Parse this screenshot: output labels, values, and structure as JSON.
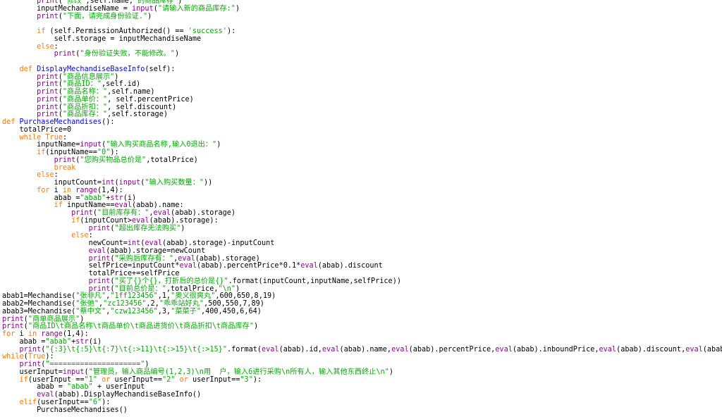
{
  "colors": {
    "background": "#ffffff",
    "text": "#000000",
    "keyword": "#ff7700",
    "builtin": "#900090",
    "string": "#00aa00",
    "definition": "#0000ff"
  },
  "lines": [
    [
      [
        "bi",
        "        print"
      ],
      [
        "txt",
        "("
      ],
      [
        "str",
        "\"修改\""
      ],
      [
        "txt",
        ",self.name,"
      ],
      [
        "str",
        "\"的商品库存\""
      ],
      [
        "txt",
        ")"
      ]
    ],
    [
      [
        "txt",
        "        inputMechandiseName = "
      ],
      [
        "bi",
        "input"
      ],
      [
        "txt",
        "("
      ],
      [
        "str",
        "\"请输入新的商品库存:\""
      ],
      [
        "txt",
        ")"
      ]
    ],
    [
      [
        "bi",
        "        print"
      ],
      [
        "txt",
        "("
      ],
      [
        "str",
        "\"下面，请完成身份验证.\""
      ],
      [
        "txt",
        ")"
      ]
    ],
    [
      [
        "txt",
        " "
      ]
    ],
    [
      [
        "kw",
        "        if"
      ],
      [
        "txt",
        " (self.PermissionAuthorized() == "
      ],
      [
        "str",
        "'success'"
      ],
      [
        "txt",
        "):"
      ]
    ],
    [
      [
        "txt",
        "            self.storage = inputMechandiseName"
      ]
    ],
    [
      [
        "kw",
        "        else"
      ],
      [
        "txt",
        ":"
      ]
    ],
    [
      [
        "bi",
        "            print"
      ],
      [
        "txt",
        "("
      ],
      [
        "str",
        "\"身份验证失败，不能修改。\""
      ],
      [
        "txt",
        ")"
      ]
    ],
    [
      [
        "txt",
        " "
      ]
    ],
    [
      [
        "kw",
        "    def"
      ],
      [
        "txt",
        " "
      ],
      [
        "def",
        "DisplayMechandiseBaseInfo"
      ],
      [
        "txt",
        "(self):"
      ]
    ],
    [
      [
        "bi",
        "        print"
      ],
      [
        "txt",
        "("
      ],
      [
        "str",
        "\"商品信息展示\""
      ],
      [
        "txt",
        ")"
      ]
    ],
    [
      [
        "bi",
        "        print"
      ],
      [
        "txt",
        "("
      ],
      [
        "str",
        "\"商品ID：\""
      ],
      [
        "txt",
        ",self.id)"
      ]
    ],
    [
      [
        "bi",
        "        print"
      ],
      [
        "txt",
        "("
      ],
      [
        "str",
        "\"商品名称：\""
      ],
      [
        "txt",
        ",self.name)"
      ]
    ],
    [
      [
        "bi",
        "        print"
      ],
      [
        "txt",
        "("
      ],
      [
        "str",
        "\"商品单价：\""
      ],
      [
        "txt",
        ", self.percentPrice)"
      ]
    ],
    [
      [
        "bi",
        "        print"
      ],
      [
        "txt",
        "("
      ],
      [
        "str",
        "\"商品折扣：\""
      ],
      [
        "txt",
        ", self.discount)"
      ]
    ],
    [
      [
        "bi",
        "        print"
      ],
      [
        "txt",
        "("
      ],
      [
        "str",
        "\"商品库存：\""
      ],
      [
        "txt",
        ",self.storage)"
      ]
    ],
    [
      [
        "kw",
        "def"
      ],
      [
        "txt",
        " "
      ],
      [
        "def",
        "PurchaseMechandises"
      ],
      [
        "txt",
        "():"
      ]
    ],
    [
      [
        "txt",
        "    totalPrice=0"
      ]
    ],
    [
      [
        "kw",
        "    while"
      ],
      [
        "txt",
        " "
      ],
      [
        "kw",
        "True"
      ],
      [
        "txt",
        ":"
      ]
    ],
    [
      [
        "txt",
        "        inputName="
      ],
      [
        "bi",
        "input"
      ],
      [
        "txt",
        "("
      ],
      [
        "str",
        "\"输入购买商品名称,输入0退出：\""
      ],
      [
        "txt",
        ")"
      ]
    ],
    [
      [
        "kw",
        "        if"
      ],
      [
        "txt",
        "(inputName=="
      ],
      [
        "str",
        "\"0\""
      ],
      [
        "txt",
        "):"
      ]
    ],
    [
      [
        "bi",
        "            print"
      ],
      [
        "txt",
        "("
      ],
      [
        "str",
        "\"您购买物品总价是\""
      ],
      [
        "txt",
        ",totalPrice)"
      ]
    ],
    [
      [
        "kw",
        "            break"
      ]
    ],
    [
      [
        "kw",
        "        else"
      ],
      [
        "txt",
        ":"
      ]
    ],
    [
      [
        "txt",
        "            inputCount="
      ],
      [
        "bi",
        "int"
      ],
      [
        "txt",
        "("
      ],
      [
        "bi",
        "input"
      ],
      [
        "txt",
        "("
      ],
      [
        "str",
        "\"输入购买数量：\""
      ],
      [
        "txt",
        "))"
      ]
    ],
    [
      [
        "kw",
        "        for"
      ],
      [
        "txt",
        " i "
      ],
      [
        "kw",
        "in"
      ],
      [
        "txt",
        " "
      ],
      [
        "bi",
        "range"
      ],
      [
        "txt",
        "(1,4):"
      ]
    ],
    [
      [
        "txt",
        "            abab ="
      ],
      [
        "str",
        "\"abab\""
      ],
      [
        "txt",
        "+"
      ],
      [
        "bi",
        "str"
      ],
      [
        "txt",
        "(i)"
      ]
    ],
    [
      [
        "kw",
        "            if"
      ],
      [
        "txt",
        " inputName=="
      ],
      [
        "bi",
        "eval"
      ],
      [
        "txt",
        "(abab).name:"
      ]
    ],
    [
      [
        "bi",
        "                print"
      ],
      [
        "txt",
        "("
      ],
      [
        "str",
        "\"目前库存有：\""
      ],
      [
        "txt",
        ","
      ],
      [
        "bi",
        "eval"
      ],
      [
        "txt",
        "(abab).storage)"
      ]
    ],
    [
      [
        "kw",
        "                if"
      ],
      [
        "txt",
        "(inputCount>"
      ],
      [
        "bi",
        "eval"
      ],
      [
        "txt",
        "(abab).storage):"
      ]
    ],
    [
      [
        "bi",
        "                    print"
      ],
      [
        "txt",
        "("
      ],
      [
        "str",
        "\"超出库存无法购买\""
      ],
      [
        "txt",
        ")"
      ]
    ],
    [
      [
        "kw",
        "                else"
      ],
      [
        "txt",
        ":"
      ]
    ],
    [
      [
        "txt",
        "                    newCount="
      ],
      [
        "bi",
        "int"
      ],
      [
        "txt",
        "("
      ],
      [
        "bi",
        "eval"
      ],
      [
        "txt",
        "(abab).storage)-inputCount"
      ]
    ],
    [
      [
        "bi",
        "                    eval"
      ],
      [
        "txt",
        "(abab).storage=newCount"
      ]
    ],
    [
      [
        "bi",
        "                    print"
      ],
      [
        "txt",
        "("
      ],
      [
        "str",
        "\"采购后库存有：\""
      ],
      [
        "txt",
        ","
      ],
      [
        "bi",
        "eval"
      ],
      [
        "txt",
        "(abab).storage)"
      ]
    ],
    [
      [
        "txt",
        "                    selfPrice=inputCount*"
      ],
      [
        "bi",
        "eval"
      ],
      [
        "txt",
        "(abab).percentPrice*0.1*"
      ],
      [
        "bi",
        "eval"
      ],
      [
        "txt",
        "(abab).discount"
      ]
    ],
    [
      [
        "txt",
        "                    totalPrice+=selfPrice"
      ]
    ],
    [
      [
        "bi",
        "                    print"
      ],
      [
        "txt",
        "("
      ],
      [
        "str",
        "\"买了{}个{}，打折后的总价是{}\""
      ],
      [
        "txt",
        ".format(inputCount,inputName,selfPrice))"
      ]
    ],
    [
      [
        "bi",
        "                    print"
      ],
      [
        "txt",
        "("
      ],
      [
        "str",
        "\"目前总价是：\""
      ],
      [
        "txt",
        ",totalPrice,"
      ],
      [
        "str",
        "\"\\n\""
      ],
      [
        "txt",
        ")"
      ]
    ],
    [
      [
        "txt",
        "abab1=Mechandise("
      ],
      [
        "str",
        "\"张非凡\""
      ],
      [
        "txt",
        ","
      ],
      [
        "str",
        "\"1ff123456\""
      ],
      [
        "txt",
        ",1,"
      ],
      [
        "str",
        "\"奥义很爽丸\""
      ],
      [
        "txt",
        ",600,650,8,19)"
      ]
    ],
    [
      [
        "txt",
        "abab2=Mechandise("
      ],
      [
        "str",
        "\"张弛\""
      ],
      [
        "txt",
        ","
      ],
      [
        "str",
        "\"zc123456\""
      ],
      [
        "txt",
        ",2,"
      ],
      [
        "str",
        "\"乖乖站好丸\""
      ],
      [
        "txt",
        ",500,550,7,89)"
      ]
    ],
    [
      [
        "txt",
        "abab3=Mechandise("
      ],
      [
        "str",
        "\"蔡中文\""
      ],
      [
        "txt",
        ","
      ],
      [
        "str",
        "\"czw123456\""
      ],
      [
        "txt",
        ",3,"
      ],
      [
        "str",
        "\"菜菜子\""
      ],
      [
        "txt",
        ",400,450,6,64)"
      ]
    ],
    [
      [
        "bi",
        "print"
      ],
      [
        "txt",
        "("
      ],
      [
        "str",
        "\"商单商品展示\""
      ],
      [
        "txt",
        ")"
      ]
    ],
    [
      [
        "bi",
        "print"
      ],
      [
        "txt",
        "("
      ],
      [
        "str",
        "\"商品ID\\t商品名称\\t商品单价\\t商品进货价\\t商品折扣\\t商品库存\""
      ],
      [
        "txt",
        ")"
      ]
    ],
    [
      [
        "kw",
        "for"
      ],
      [
        "txt",
        " i "
      ],
      [
        "kw",
        "in"
      ],
      [
        "txt",
        " "
      ],
      [
        "bi",
        "range"
      ],
      [
        "txt",
        "(1,4):"
      ]
    ],
    [
      [
        "txt",
        "    abab ="
      ],
      [
        "str",
        "\"abab\""
      ],
      [
        "txt",
        "+"
      ],
      [
        "bi",
        "str"
      ],
      [
        "txt",
        "(i)"
      ]
    ],
    [
      [
        "bi",
        "    print"
      ],
      [
        "txt",
        "("
      ],
      [
        "str",
        "\"{:3}\\t{:5}\\t{:7}\\t{:>11}\\t{:>15}\\t{:>15}\""
      ],
      [
        "txt",
        ".format("
      ],
      [
        "bi",
        "eval"
      ],
      [
        "txt",
        "(abab).id,"
      ],
      [
        "bi",
        "eval"
      ],
      [
        "txt",
        "(abab).name,"
      ],
      [
        "bi",
        "eval"
      ],
      [
        "txt",
        "(abab).percentPrice,"
      ],
      [
        "bi",
        "eval"
      ],
      [
        "txt",
        "(abab).inboundPrice,"
      ],
      [
        "bi",
        "eval"
      ],
      [
        "txt",
        "(abab).discount,"
      ],
      [
        "bi",
        "eval"
      ],
      [
        "txt",
        "(abab).storage))"
      ]
    ],
    [
      [
        "kw",
        "while"
      ],
      [
        "txt",
        "("
      ],
      [
        "kw",
        "True"
      ],
      [
        "txt",
        "):"
      ]
    ],
    [
      [
        "bi",
        "    print"
      ],
      [
        "txt",
        "("
      ],
      [
        "str",
        "\"=====================\""
      ],
      [
        "txt",
        ")"
      ]
    ],
    [
      [
        "txt",
        "    userInput="
      ],
      [
        "bi",
        "input"
      ],
      [
        "txt",
        "("
      ],
      [
        "str",
        "\"管理员，输入商品编号(1,2,3)\\n用  户，输入6进行采购\\n所有人，输入其他东西终止\\n\""
      ],
      [
        "txt",
        ")"
      ]
    ],
    [
      [
        "kw",
        "    if"
      ],
      [
        "txt",
        "(userInput =="
      ],
      [
        "str",
        "\"1\""
      ],
      [
        "txt",
        " "
      ],
      [
        "kw",
        "or"
      ],
      [
        "txt",
        " userInput=="
      ],
      [
        "str",
        "\"2\""
      ],
      [
        "txt",
        " "
      ],
      [
        "kw",
        "or"
      ],
      [
        "txt",
        " userInput=="
      ],
      [
        "str",
        "\"3\""
      ],
      [
        "txt",
        "):"
      ]
    ],
    [
      [
        "txt",
        "        abab = "
      ],
      [
        "str",
        "\"abab\""
      ],
      [
        "txt",
        " + userInput"
      ]
    ],
    [
      [
        "bi",
        "        eval"
      ],
      [
        "txt",
        "(abab).DisplayMechandiseBaseInfo()"
      ]
    ],
    [
      [
        "kw",
        "    elif"
      ],
      [
        "txt",
        "(userInput=="
      ],
      [
        "str",
        "\"6\""
      ],
      [
        "txt",
        "):"
      ]
    ],
    [
      [
        "txt",
        "        PurchaseMechandises()"
      ]
    ]
  ]
}
